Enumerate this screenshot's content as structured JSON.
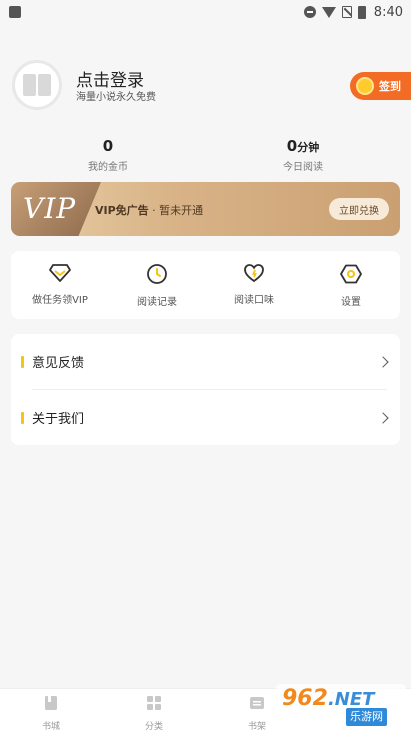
{
  "status_bar": {
    "time": "8:40"
  },
  "profile": {
    "login_title": "点击登录",
    "login_subtitle": "海量小说永久免费",
    "sign_in_label": "签到"
  },
  "stats": [
    {
      "value": "0",
      "unit": "",
      "label": "我的金币"
    },
    {
      "value": "0",
      "unit": "分钟",
      "label": "今日阅读"
    }
  ],
  "vip": {
    "logo": "VIP",
    "title": "VIP免广告",
    "status": "· 暂未开通",
    "button": "立即兑换"
  },
  "actions": [
    {
      "label": "做任务领VIP",
      "icon": "diamond-icon"
    },
    {
      "label": "阅读记录",
      "icon": "clock-icon"
    },
    {
      "label": "阅读口味",
      "icon": "heart-icon"
    },
    {
      "label": "设置",
      "icon": "settings-hexagon-icon"
    }
  ],
  "menu": [
    {
      "label": "意见反馈"
    },
    {
      "label": "关于我们"
    }
  ],
  "bottom_nav": [
    {
      "label": "书城",
      "icon": "book-icon"
    },
    {
      "label": "分类",
      "icon": "grid-icon"
    },
    {
      "label": "书架",
      "icon": "shelf-icon"
    }
  ],
  "watermark": {
    "logo": "962",
    "logo_suffix": ".NET",
    "site": "乐游网"
  },
  "colors": {
    "accent": "#f5c515",
    "sign_button": "#f36c25",
    "vip_gold": "#d9b488"
  }
}
